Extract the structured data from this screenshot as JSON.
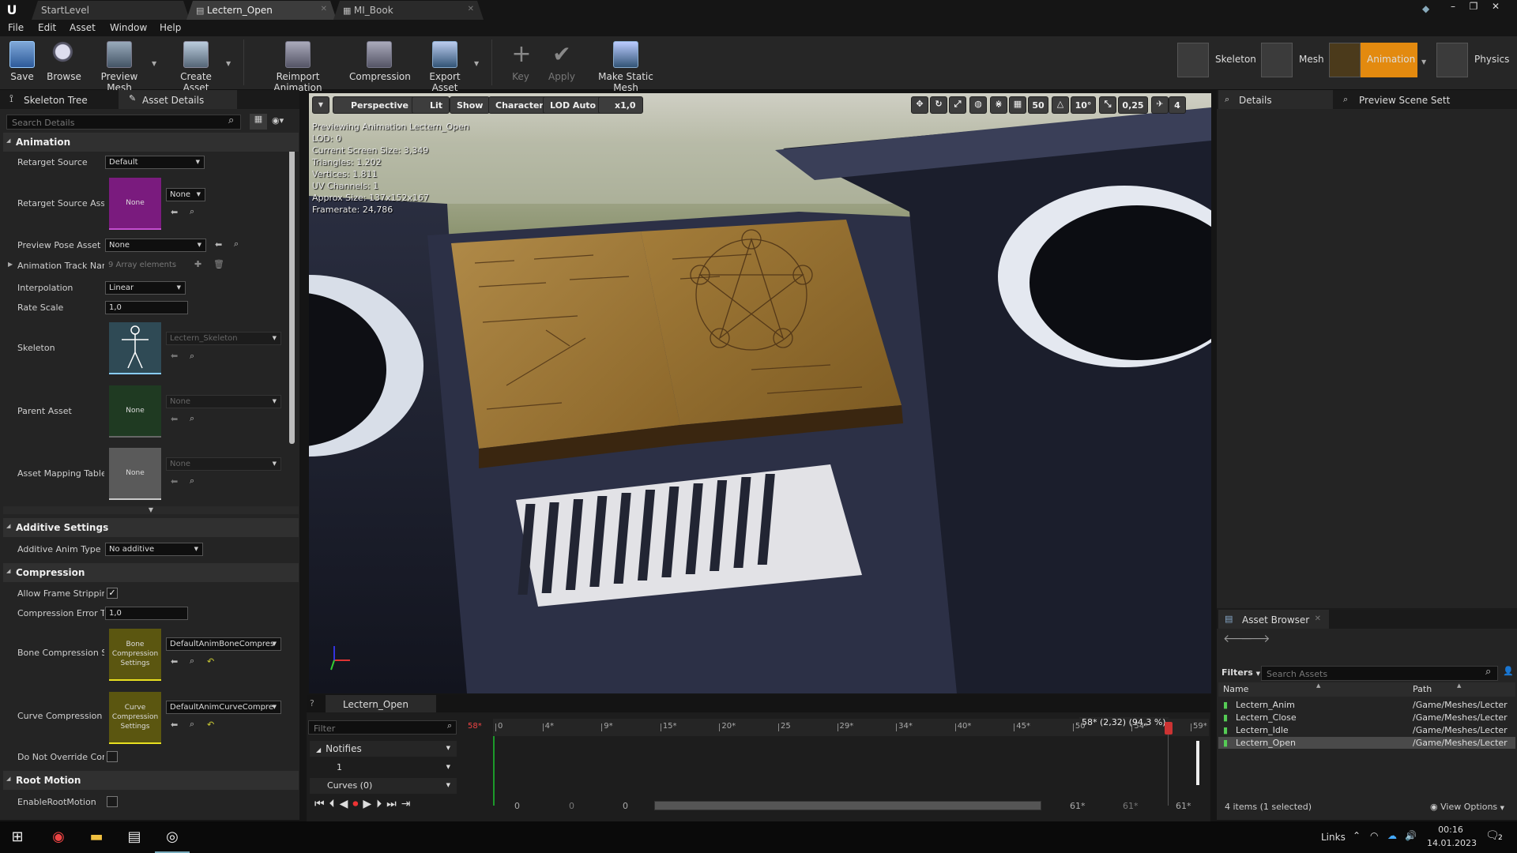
{
  "titlebar": {
    "tabs": [
      {
        "label": "StartLevel"
      },
      {
        "label": "Lectern_Open"
      },
      {
        "label": "MI_Book"
      }
    ]
  },
  "menu": [
    "File",
    "Edit",
    "Asset",
    "Window",
    "Help"
  ],
  "toolbar": {
    "save": "Save",
    "browse": "Browse",
    "preview_mesh": "Preview Mesh",
    "create_asset": "Create Asset",
    "reimport": "Reimport Animation",
    "compression": "Compression",
    "export": "Export Asset",
    "key": "Key",
    "apply": "Apply",
    "make_static": "Make Static Mesh"
  },
  "modes": {
    "skeleton": "Skeleton",
    "mesh": "Mesh",
    "animation": "Animation",
    "physics": "Physics"
  },
  "left_panel": {
    "tab1": "Skeleton Tree",
    "tab2": "Asset Details",
    "search_placeholder": "Search Details",
    "sections": {
      "animation": "Animation",
      "additive": "Additive Settings",
      "compression": "Compression",
      "root_motion": "Root Motion"
    },
    "props": {
      "retarget_source": {
        "label": "Retarget Source",
        "value": "Default"
      },
      "retarget_source_asset": {
        "label": "Retarget Source Asse",
        "thumb": "None",
        "value": "None"
      },
      "preview_pose": {
        "label": "Preview Pose Asset",
        "value": "None"
      },
      "track_names": {
        "label": "Animation Track Nam",
        "value": "9 Array elements"
      },
      "interpolation": {
        "label": "Interpolation",
        "value": "Linear"
      },
      "rate_scale": {
        "label": "Rate Scale",
        "value": "1,0"
      },
      "skeleton": {
        "label": "Skeleton",
        "value": "Lectern_Skeleton"
      },
      "parent_asset": {
        "label": "Parent Asset",
        "thumb": "None",
        "value": "None"
      },
      "asset_mapping": {
        "label": "Asset Mapping Table",
        "thumb": "None",
        "value": "None"
      },
      "additive_type": {
        "label": "Additive Anim Type",
        "value": "No additive"
      },
      "frame_stripping": {
        "label": "Allow Frame Stripping"
      },
      "compression_error": {
        "label": "Compression Error Th",
        "value": "1,0"
      },
      "bone_compression": {
        "label": "Bone Compression Se",
        "thumb": "Bone Compression Settings",
        "value": "DefaultAnimBoneCompres"
      },
      "curve_compression": {
        "label": "Curve Compression S",
        "thumb": "Curve Compression Settings",
        "value": "DefaultAnimCurveCompre"
      },
      "do_not_override": {
        "label": "Do Not Override Com"
      },
      "enable_root_motion": {
        "label": "EnableRootMotion"
      }
    }
  },
  "viewport": {
    "buttons": {
      "perspective": "Perspective",
      "lit": "Lit",
      "show": "Show",
      "character": "Character",
      "lod": "LOD Auto",
      "speed": "x1,0"
    },
    "right_tools": {
      "grid": "50",
      "angle": "10°",
      "scale": "0,25",
      "cam": "4"
    },
    "stats": [
      "Previewing Animation Lectern_Open",
      "LOD: 0",
      "Current Screen Size: 3,349",
      "Triangles: 1.202",
      "Vertices: 1.811",
      "UV Channels: 1",
      "Approx Size: 137x152x167",
      "Framerate: 24,786"
    ]
  },
  "timeline": {
    "tab": "Lectern_Open",
    "filter_placeholder": "Filter",
    "frame_red": "58*",
    "current": "58* (2,32) (94,3 %)",
    "notifies": "Notifies",
    "track1": "1",
    "curves": "Curves  (0)",
    "ticks": [
      {
        "label": "0",
        "pos": 0
      },
      {
        "label": "4*",
        "pos": 4
      },
      {
        "label": "9*",
        "pos": 9
      },
      {
        "label": "15*",
        "pos": 14
      },
      {
        "label": "20*",
        "pos": 19
      },
      {
        "label": "25",
        "pos": 24
      },
      {
        "label": "29*",
        "pos": 29
      },
      {
        "label": "34*",
        "pos": 34
      },
      {
        "label": "40*",
        "pos": 39
      },
      {
        "label": "45*",
        "pos": 44
      },
      {
        "label": "50",
        "pos": 49
      },
      {
        "label": "54*",
        "pos": 54
      },
      {
        "label": "59*",
        "pos": 59
      }
    ],
    "range_values": [
      "0",
      "0",
      "0",
      "61*",
      "61*",
      "61*"
    ]
  },
  "right_panel": {
    "tab_details": "Details",
    "tab_preview": "Preview Scene Sett",
    "asset_browser": "Asset Browser",
    "filters": "Filters",
    "search_placeholder": "Search Assets",
    "col_name": "Name",
    "col_path": "Path",
    "assets": [
      {
        "name": "Lectern_Anim",
        "path": "/Game/Meshes/Lecter"
      },
      {
        "name": "Lectern_Close",
        "path": "/Game/Meshes/Lecter"
      },
      {
        "name": "Lectern_Idle",
        "path": "/Game/Meshes/Lecter"
      },
      {
        "name": "Lectern_Open",
        "path": "/Game/Meshes/Lecter"
      }
    ],
    "status": "4 items (1 selected)",
    "view_options": "View Options"
  },
  "taskbar": {
    "links": "Links",
    "time": "00:16",
    "date": "14.01.2023",
    "notif": "2"
  }
}
